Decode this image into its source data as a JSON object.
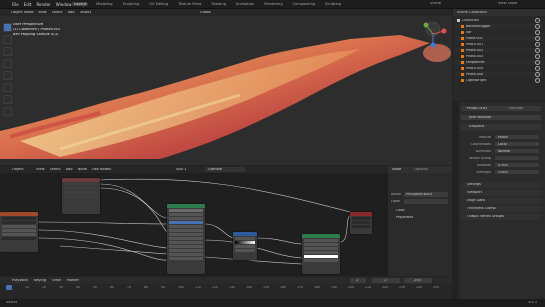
{
  "menu": [
    "File",
    "Edit",
    "Render",
    "Window",
    "Help"
  ],
  "workspace_tabs": [
    "Layout",
    "Modeling",
    "Sculpting",
    "UV Editing",
    "Texture Paint",
    "Shading",
    "Animation",
    "Rendering",
    "Compositing",
    "Scripting"
  ],
  "active_tab": "Layout",
  "scene_name": "Scene",
  "view_layer": "View Layer",
  "viewport": {
    "mode": "Object Mode",
    "menus": [
      "View",
      "Select",
      "Add",
      "Object"
    ],
    "overlay_lines": [
      "User Perspective",
      "(1) Collection | Photo0163",
      "Bell Pepping Sample 0(3)"
    ],
    "orientation": "Global"
  },
  "outliner": {
    "title": "Scene Collection",
    "items": [
      "Collection",
      "balloonbugger",
      "liar",
      "Plane.001",
      "Photo.001",
      "Photo.002",
      "Photo.003",
      "cellpatcher",
      "Photo.005",
      "Photo.006",
      "Lightsbright"
    ]
  },
  "properties": {
    "object": "Photo.0163",
    "modifier_tab": "Modifier",
    "add_modifier": "Add Modifier",
    "modifier": "Displace",
    "fields": [
      {
        "label": "Texture",
        "value": "Photo"
      },
      {
        "label": "Coordinates",
        "value": "Local"
      },
      {
        "label": "Direction",
        "value": "Normal"
      },
      {
        "label": "Vertex Group",
        "value": ""
      },
      {
        "label": "Midlevel",
        "value": "0.500"
      },
      {
        "label": "Strength",
        "value": "1.000"
      }
    ],
    "sections": [
      "Settings",
      "Viewport",
      "Edge Data",
      "Thickness Clamp",
      "Output Vertex Groups"
    ]
  },
  "node_editor": {
    "mode": "Object",
    "menus": [
      "View",
      "Select",
      "Add",
      "Node",
      "Use Nodes"
    ],
    "slot": "Slot 1",
    "material": "Gamble",
    "sidebar_tabs": [
      "Node",
      "Options"
    ],
    "sidebar": {
      "name_label": "Name",
      "name_value": "Principled BSDF",
      "label_label": "Label",
      "sections": [
        "Color",
        "Properties"
      ]
    }
  },
  "timeline": {
    "menus": [
      "Playback",
      "Keying",
      "View",
      "Marker"
    ],
    "frame_current": "1",
    "start": "1",
    "end": "250",
    "ticks": [
      "0",
      "10",
      "20",
      "30",
      "40",
      "50",
      "60",
      "70",
      "80",
      "90",
      "100",
      "110",
      "120",
      "130",
      "140",
      "150",
      "160",
      "170",
      "180",
      "190",
      "200",
      "210",
      "220",
      "230",
      "240",
      "250"
    ]
  },
  "status": {
    "left": "Select",
    "right": "3.4.1"
  },
  "colors": {
    "accent": "#e87d0d",
    "node_green": "#2e7d4f",
    "node_blue": "#2b5b9a",
    "node_red": "#8a2a2a"
  }
}
